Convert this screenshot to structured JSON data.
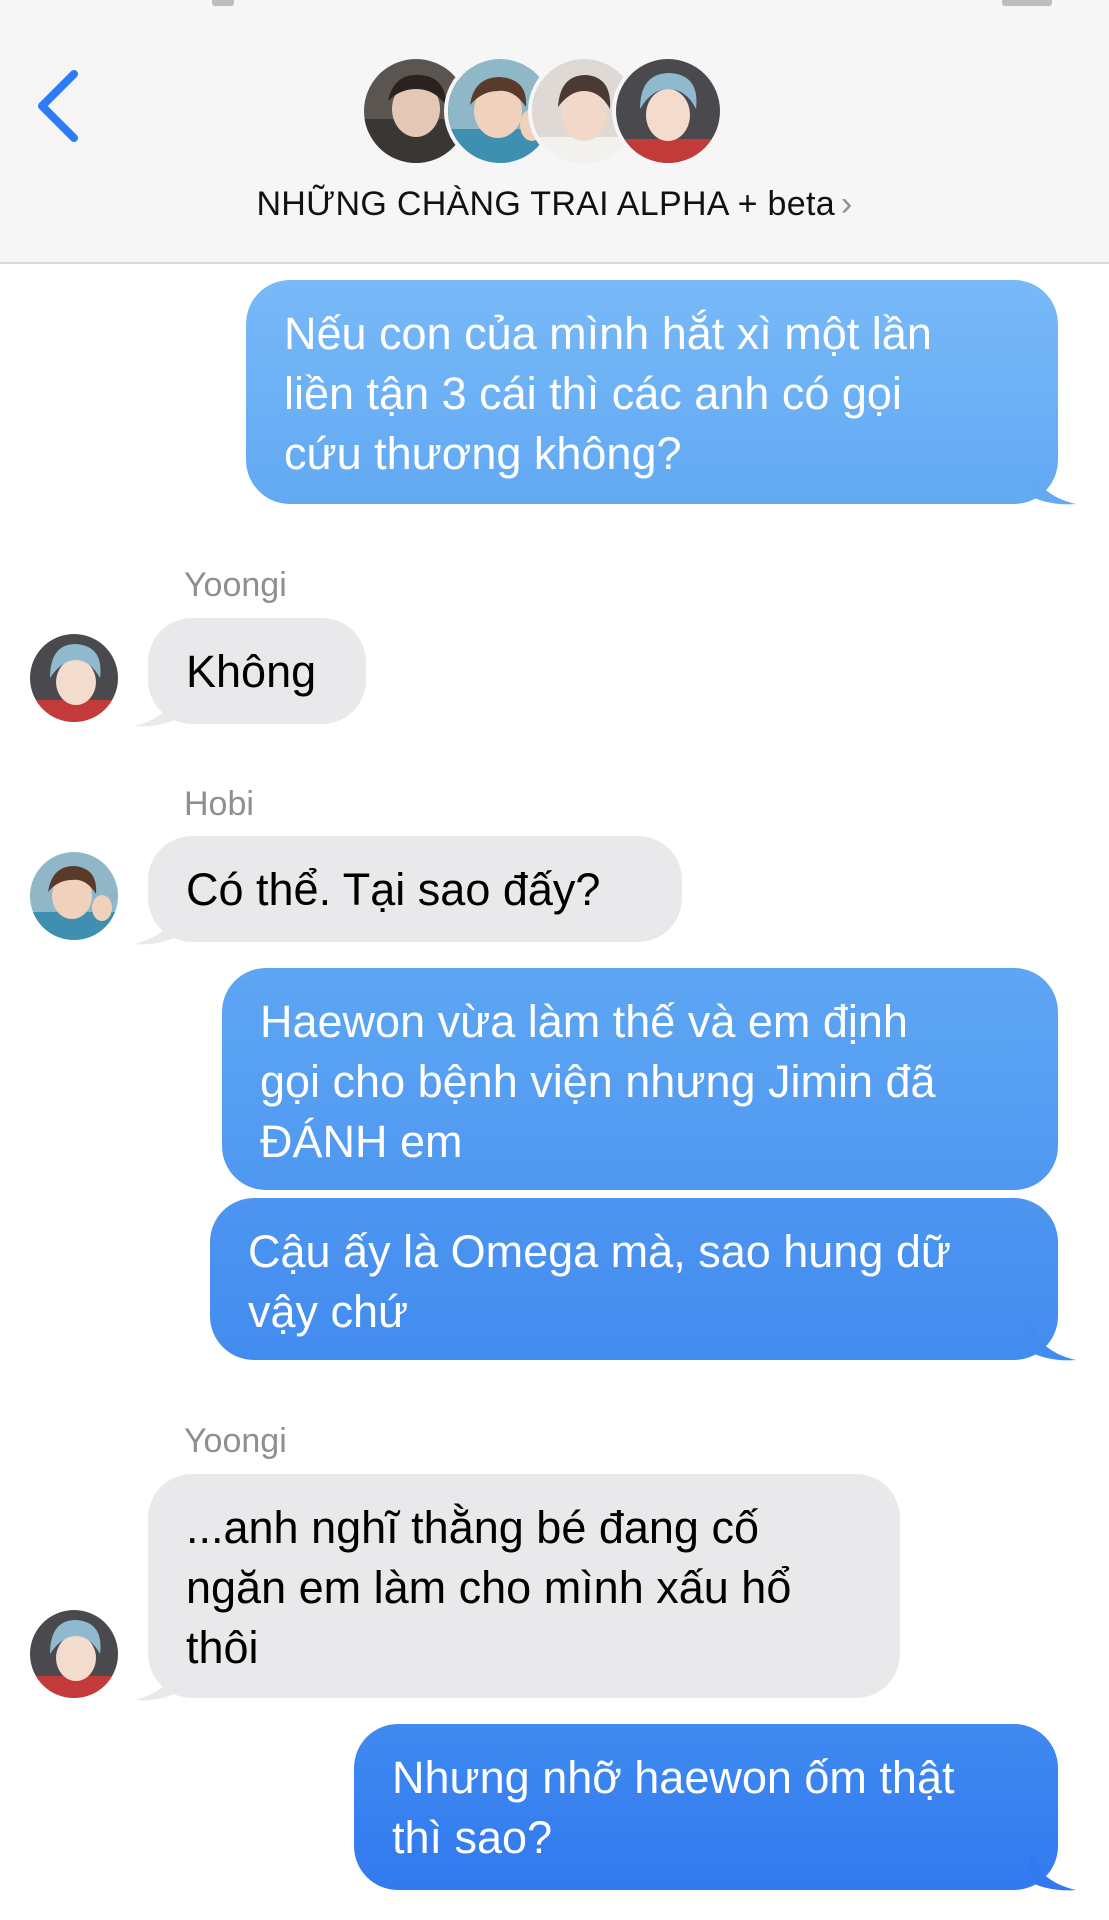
{
  "header": {
    "back_icon": "chevron-left-icon",
    "group_name": "NHỮNG CHÀNG TRAI ALPHA + beta",
    "chevron_icon": "chevron-right-icon",
    "accent": "#2f7bf6"
  },
  "messages": [
    {
      "id": "m1",
      "direction": "outgoing",
      "text": "Nếu con của mình hắt xì  một lần\nliền tận 3 cái thì các anh có gọi\ncứu thương không?"
    },
    {
      "id": "m2",
      "direction": "incoming",
      "sender": "Yoongi",
      "text": "Không"
    },
    {
      "id": "m3",
      "direction": "incoming",
      "sender": "Hobi",
      "text": "Có thể. Tại sao đấy?"
    },
    {
      "id": "m4",
      "direction": "outgoing",
      "text": "Haewon vừa làm thế và em định\ngọi cho bệnh viện nhưng Jimin đã\nĐÁNH em"
    },
    {
      "id": "m5",
      "direction": "outgoing",
      "text": "Cậu ấy là Omega mà, sao hung dữ\nvậy chứ"
    },
    {
      "id": "m6",
      "direction": "incoming",
      "sender": "Yoongi",
      "text": "...anh nghĩ thằng bé đang cố\nngăn em làm cho mình xấu hổ\nthôi"
    },
    {
      "id": "m7",
      "direction": "outgoing",
      "text": "Nhưng nhỡ haewon ốm thật\nthì sao?"
    }
  ],
  "colors": {
    "outgoing_top": "#6fb6f7",
    "outgoing_bottom": "#3478f6",
    "incoming": "#e9e9eb",
    "sender_label": "#8e8e93"
  }
}
